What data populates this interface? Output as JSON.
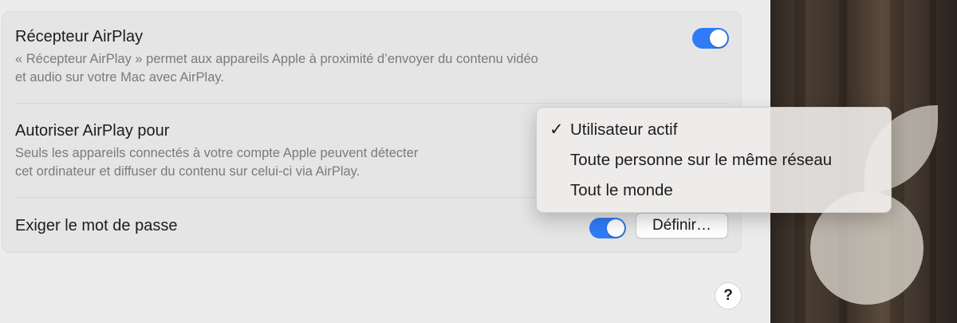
{
  "airplay_receiver": {
    "title": "Récepteur AirPlay",
    "description_line1": "« Récepteur AirPlay » permet aux appareils Apple à proximité d’envoyer du contenu vidéo",
    "description_line2": "et audio sur votre Mac avec AirPlay.",
    "enabled": true
  },
  "allow_airplay": {
    "title": "Autoriser AirPlay pour",
    "description_line1": "Seuls les appareils connectés à votre compte Apple peuvent détecter",
    "description_line2": "cet ordinateur et diffuser du contenu sur celui-ci via AirPlay."
  },
  "require_password": {
    "title": "Exiger le mot de passe",
    "enabled": true,
    "define_label": "Définir…"
  },
  "menu": {
    "items": [
      {
        "label": "Utilisateur actif",
        "checked": true
      },
      {
        "label": "Toute personne sur le même réseau",
        "checked": false
      },
      {
        "label": "Tout le monde",
        "checked": false
      }
    ],
    "check_glyph": "✓"
  },
  "help_label": "?",
  "colors": {
    "accent": "#2f7cf6",
    "background": "#ececec"
  }
}
